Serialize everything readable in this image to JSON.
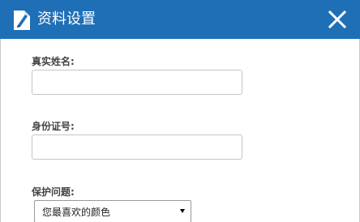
{
  "dialog": {
    "title": "资料设置",
    "title_icon": "edit-document-icon",
    "close_icon": "close-icon",
    "accent_color": "#1f6fb7"
  },
  "form": {
    "real_name": {
      "label": "真实姓名:",
      "value": "",
      "placeholder": ""
    },
    "id_number": {
      "label": "身份证号:",
      "value": "",
      "placeholder": ""
    },
    "security_question": {
      "label": "保护问题:",
      "selected": "您最喜欢的颜色"
    }
  }
}
